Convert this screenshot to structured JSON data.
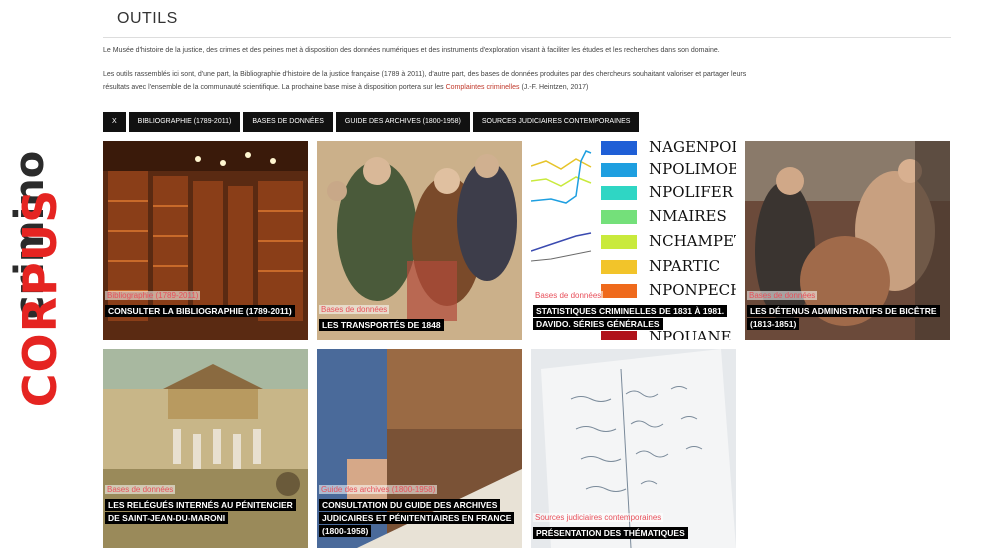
{
  "brand": {
    "corpus": "CORPUS",
    "crimino": "crimino"
  },
  "page": {
    "title": "OUTILS",
    "intro_1": "Le Musée d'histoire de la justice, des crimes et des peines met à disposition des données numériques et des instruments d'exploration visant à faciliter les études et les recherches dans son domaine.",
    "intro_2_line1": "Les outils rassemblés ici sont, d'une part, la Bibliographie d'histoire de la justice française (1789 à 2011), d'autre part, des bases de données produites par des chercheurs souhaitant valoriser et partager leurs",
    "intro_2_line2_pre": "résultats avec l'ensemble de la communauté scientifique. La prochaine base mise à disposition portera sur les",
    "intro_2_link": "Complaintes criminelles",
    "intro_2_line2_post": "(J.-F. Heintzen, 2017)"
  },
  "filters": [
    "X",
    "BIBLIOGRAPHIE (1789-2011)",
    "BASES DE DONNÉES",
    "GUIDE DES ARCHIVES (1800-1958)",
    "SOURCES JUDICIAIRES CONTEMPORAINES"
  ],
  "cards": [
    {
      "category": "Bibliographie (1789-2011)",
      "title": "CONSULTER LA BIBLIOGRAPHIE (1789-2011)"
    },
    {
      "category": "Bases de données",
      "title": "LES TRANSPORTÉS DE 1848"
    },
    {
      "category": "Bases de données",
      "title": "STATISTIQUES CRIMINELLES DE 1831 À 1981. DAVIDO. SÉRIES GÉNÉRALES"
    },
    {
      "category": "Bases de données",
      "title": "LES DÉTENUS ADMINISTRATIFS DE BICÊTRE (1813-1851)"
    },
    {
      "category": "Bases de données",
      "title": "LES RELÉGUÉS INTERNÉS AU PÉNITENCIER DE SAINT-JEAN-DU-MARONI"
    },
    {
      "category": "Guide des archives (1800-1958)",
      "title": "CONSULTATION DU GUIDE DES ARCHIVES JUDICAIRES ET PÉNITENTIAIRES EN FRANCE (1800-1958)"
    },
    {
      "category": "Sources judiciaires contemporaines",
      "title": "PRÉSENTATION DES THÉMATIQUES"
    }
  ],
  "stats_legend": [
    {
      "label": "NAGENPOL",
      "color": "#1f5fd6"
    },
    {
      "label": "NPOLIMOB",
      "color": "#1e9fe0"
    },
    {
      "label": "NPOLIFER",
      "color": "#2fd6c4"
    },
    {
      "label": "NMAIRES",
      "color": "#74e07a"
    },
    {
      "label": "NCHAMPET",
      "color": "#c9ea3c"
    },
    {
      "label": "NPARTIC",
      "color": "#f2c42a"
    },
    {
      "label": "NPONPECH",
      "color": "#ef6a1c"
    },
    {
      "label": "NPOUANE",
      "color": "#b0121b"
    }
  ],
  "colors": {
    "accent": "#e52421",
    "category": "#e8505b",
    "filter_bg": "#111111"
  }
}
